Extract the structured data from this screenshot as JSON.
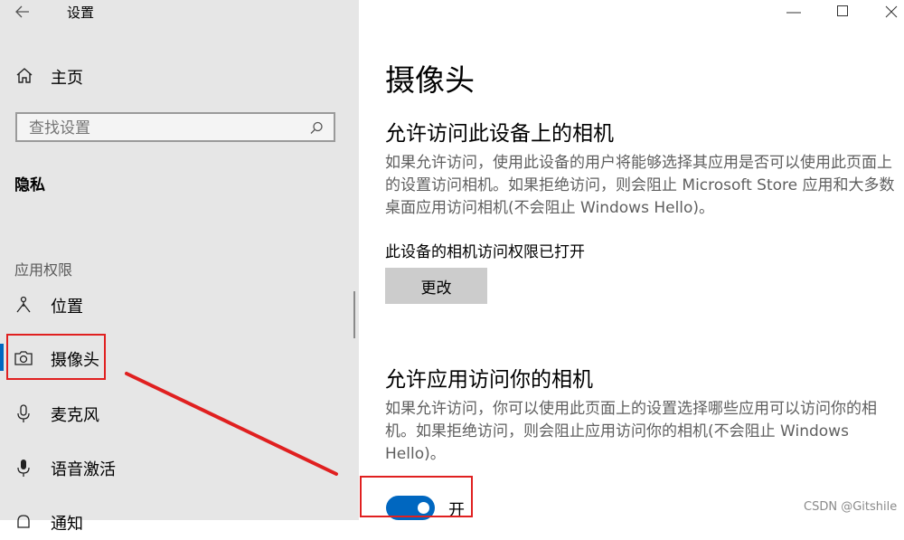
{
  "window": {
    "title": "设置",
    "controls": [
      "minimize",
      "maximize",
      "close"
    ]
  },
  "sidebar": {
    "home_label": "主页",
    "search_placeholder": "查找设置",
    "section_title": "隐私",
    "group_title": "应用权限",
    "items": [
      {
        "label": "位置",
        "icon": "location-icon"
      },
      {
        "label": "摄像头",
        "icon": "camera-icon",
        "selected": true
      },
      {
        "label": "麦克风",
        "icon": "microphone-icon"
      },
      {
        "label": "语音激活",
        "icon": "voice-icon"
      },
      {
        "label": "通知",
        "icon": "notification-icon"
      }
    ]
  },
  "main": {
    "title": "摄像头",
    "section1": {
      "heading": "允许访问此设备上的相机",
      "description": "如果允许访问，使用此设备的用户将能够选择其应用是否可以使用此页面上的设置访问相机。如果拒绝访问，则会阻止 Microsoft Store 应用和大多数桌面应用访问相机(不会阻止 Windows Hello)。",
      "status": "此设备的相机访问权限已打开",
      "button": "更改"
    },
    "section2": {
      "heading": "允许应用访问你的相机",
      "description": "如果允许访问，你可以使用此页面上的设置选择哪些应用可以访问你的相机。如果拒绝访问，则会阻止应用访问你的相机(不会阻止 Windows Hello)。",
      "toggle_label": "开",
      "toggle_on": true
    }
  },
  "watermark": "CSDN @Gitshile",
  "colors": {
    "accent": "#0067c0",
    "annotation": "#e02020",
    "sidebar_bg": "#e6e6e6"
  }
}
